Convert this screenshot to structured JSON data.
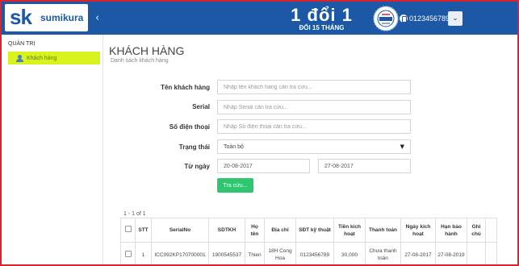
{
  "brand": {
    "logo_mark": "sk",
    "name": "sumikura"
  },
  "header": {
    "menu_toggle": "‹",
    "promo_line1": "1 đổi 1",
    "promo_line2": "ĐỔI 15 THÁNG",
    "phone": "0123456789",
    "dropdown_caret": "⌄",
    "colors": {
      "bar": "#1c58a6",
      "accent": "#d9232d"
    }
  },
  "sidebar": {
    "heading": "QUẢN TRỊ",
    "items": [
      {
        "label": "Khách hàng",
        "icon": "user-icon",
        "active": true
      }
    ]
  },
  "page": {
    "title": "KHÁCH HÀNG",
    "subtitle": "Danh sách khách hàng"
  },
  "filters": {
    "name": {
      "label": "Tên khách hàng",
      "placeholder": "Nhập tên khách hàng cần tra cứu..."
    },
    "serial": {
      "label": "Serial",
      "placeholder": "Nhập Serial cần tra cứu..."
    },
    "phone": {
      "label": "Số điện thoại",
      "placeholder": "Nhập Số điện thoại cần tra cứu..."
    },
    "status": {
      "label": "Trạng thái",
      "value": "Toàn bộ"
    },
    "date": {
      "label": "Từ ngày",
      "from": "20-08-2017",
      "to": "27-08-2017"
    },
    "search_button": "Tra cứu..."
  },
  "table": {
    "count": "1 - 1 of 1",
    "headers": [
      "",
      "STT",
      "SerialNo",
      "SDTKH",
      "Họ tên",
      "Địa chỉ",
      "SĐT kỹ thuật",
      "Tiền kích hoạt",
      "Thanh toán",
      "Ngày kích hoạt",
      "Hạn bảo hành",
      "Ghi chú"
    ],
    "rows": [
      [
        "",
        "1",
        "ICC092KP170700001",
        "1900545537",
        "Thien",
        "18H Cong Hoa",
        "0123456789",
        "30,000",
        "Chưa thanh toán",
        "27-08-2017",
        "27-08-2019",
        ""
      ]
    ]
  }
}
